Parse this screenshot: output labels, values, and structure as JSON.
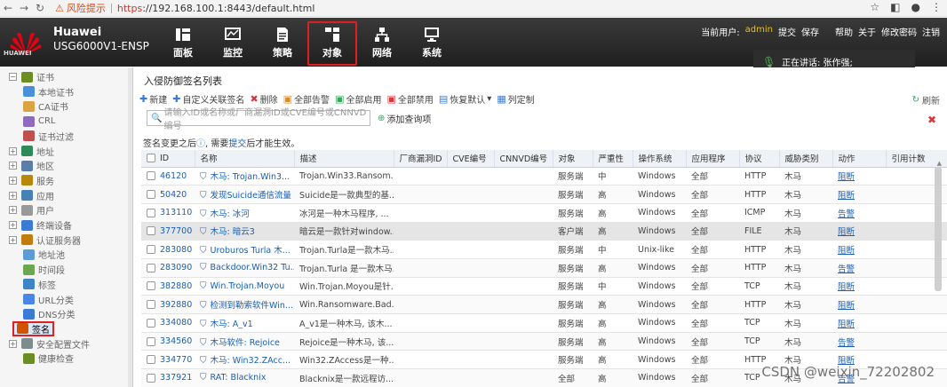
{
  "browser": {
    "warning": "风险提示",
    "url_https": "https",
    "url_rest": "://192.168.100.1:8443/default.html"
  },
  "header": {
    "brand_name": "Huawei",
    "brand_model": "USG6000V1-ENSP",
    "logo_text": "HUAWEI",
    "nav": [
      {
        "label": "面板",
        "icon": "dashboard-icon"
      },
      {
        "label": "监控",
        "icon": "monitor-icon"
      },
      {
        "label": "策略",
        "icon": "policy-icon"
      },
      {
        "label": "对象",
        "icon": "object-icon",
        "active": true
      },
      {
        "label": "网络",
        "icon": "network-icon"
      },
      {
        "label": "系统",
        "icon": "system-icon"
      }
    ],
    "current_user_label": "当前用户:",
    "user": "admin",
    "links": [
      "提交",
      "保存",
      "帮助",
      "关于",
      "修改密码",
      "注销"
    ],
    "speaking": "正在讲话: 张作强;"
  },
  "sidebar": {
    "items": [
      {
        "label": "证书",
        "level": 0,
        "toggle": "−"
      },
      {
        "label": "本地证书",
        "level": 1
      },
      {
        "label": "CA证书",
        "level": 1
      },
      {
        "label": "CRL",
        "level": 1
      },
      {
        "label": "证书过滤",
        "level": 1
      },
      {
        "label": "地址",
        "level": 0,
        "toggle": "+"
      },
      {
        "label": "地区",
        "level": 0,
        "toggle": "+"
      },
      {
        "label": "服务",
        "level": 0,
        "toggle": "+"
      },
      {
        "label": "应用",
        "level": 0,
        "toggle": "+"
      },
      {
        "label": "用户",
        "level": 0,
        "toggle": "+"
      },
      {
        "label": "终端设备",
        "level": 0,
        "toggle": "+"
      },
      {
        "label": "认证服务器",
        "level": 0,
        "toggle": "+"
      },
      {
        "label": "地址池",
        "level": 1
      },
      {
        "label": "时间段",
        "level": 1
      },
      {
        "label": "标签",
        "level": 1
      },
      {
        "label": "URL分类",
        "level": 1
      },
      {
        "label": "DNS分类",
        "level": 1
      },
      {
        "label": "签名",
        "level": 1,
        "selected": true
      },
      {
        "label": "安全配置文件",
        "level": 0,
        "toggle": "+"
      },
      {
        "label": "健康检查",
        "level": 1
      }
    ]
  },
  "content": {
    "title": "入侵防御签名列表",
    "refresh": "刷新",
    "toolbar": [
      "新建",
      "自定义关联签名",
      "删除",
      "全部告警",
      "全部启用",
      "全部禁用",
      "恢复默认",
      "列定制"
    ],
    "search_placeholder": "请输入ID或名称或厂商漏洞ID或CVE编号或CNNVD编号",
    "add_query": "添加查询项",
    "notice_pre": "签名变更之后",
    "notice_mid": ", 需要",
    "notice_link": "提交",
    "notice_post": "后才能生效。"
  },
  "table": {
    "columns": [
      "ID",
      "名称",
      "描述",
      "厂商漏洞ID",
      "CVE编号",
      "CNNVD编号",
      "对象",
      "严重性",
      "操作系统",
      "应用程序",
      "协议",
      "威胁类别",
      "动作",
      "引用计数"
    ],
    "rows": [
      {
        "id": "46120",
        "name": "木马: Trojan.Win3...",
        "desc": "Trojan.Win33.Ransom....",
        "obj": "服务端",
        "sev": "中",
        "os": "Windows",
        "app": "全部",
        "proto": "HTTP",
        "threat": "木马",
        "action": "阻断"
      },
      {
        "id": "50420",
        "name": "发现Suicide通信流量",
        "desc": "Suicide是一款典型的基...",
        "obj": "服务端",
        "sev": "高",
        "os": "Windows",
        "app": "全部",
        "proto": "HTTP",
        "threat": "木马",
        "action": "阻断"
      },
      {
        "id": "313110",
        "name": "木马: 冰河",
        "desc": "冰河是一种木马程序, ...",
        "obj": "服务端",
        "sev": "高",
        "os": "Windows",
        "app": "全部",
        "proto": "ICMP",
        "threat": "木马",
        "action": "告警"
      },
      {
        "id": "377700",
        "name": "木马: 暗云3",
        "desc": "暗云是一款针对window...",
        "obj": "客户端",
        "sev": "高",
        "os": "Windows",
        "app": "全部",
        "proto": "FILE",
        "threat": "木马",
        "action": "阻断",
        "selected": true
      },
      {
        "id": "283080",
        "name": "Uroburos Turla 木...",
        "desc": "Trojan.Turla是一款木马...",
        "obj": "服务端",
        "sev": "中",
        "os": "Unix-like",
        "app": "全部",
        "proto": "HTTP",
        "threat": "木马",
        "action": "阻断"
      },
      {
        "id": "283090",
        "name": "Backdoor.Win32 Tu...",
        "desc": "Trojan.Turla 是一款木马...",
        "obj": "服务端",
        "sev": "高",
        "os": "Windows",
        "app": "全部",
        "proto": "HTTP",
        "threat": "木马",
        "action": "告警"
      },
      {
        "id": "382880",
        "name": "Win.Trojan.Moyou",
        "desc": "Win.Trojan.Moyou是针...",
        "obj": "服务端",
        "sev": "中",
        "os": "Windows",
        "app": "全部",
        "proto": "TCP",
        "threat": "木马",
        "action": "阻断"
      },
      {
        "id": "392880",
        "name": "检测到勒索软件Win...",
        "desc": "Win.Ransomware.Bad....",
        "obj": "服务端",
        "sev": "高",
        "os": "Windows",
        "app": "全部",
        "proto": "HTTP",
        "threat": "木马",
        "action": "阻断"
      },
      {
        "id": "334080",
        "name": "木马: A_v1",
        "desc": "A_v1是一种木马, 该木...",
        "obj": "服务端",
        "sev": "高",
        "os": "Windows",
        "app": "全部",
        "proto": "TCP",
        "threat": "木马",
        "action": "阻断"
      },
      {
        "id": "334560",
        "name": "木马软件: Rejoice",
        "desc": "Rejoice是一种木马, 该...",
        "obj": "服务端",
        "sev": "高",
        "os": "Windows",
        "app": "全部",
        "proto": "TCP",
        "threat": "木马",
        "action": "告警"
      },
      {
        "id": "334770",
        "name": "木马: Win32.ZAcc...",
        "desc": "Win32.ZAccess是一种...",
        "obj": "服务端",
        "sev": "高",
        "os": "Windows",
        "app": "全部",
        "proto": "HTTP",
        "threat": "木马",
        "action": "阻断"
      },
      {
        "id": "337921",
        "name": "RAT: Blacknix",
        "desc": "Blacknix是一款远程访...",
        "obj": "全部",
        "sev": "高",
        "os": "Windows",
        "app": "全部",
        "proto": "TCP",
        "threat": "木马",
        "action": "告警"
      }
    ]
  },
  "watermark": "CSDN @weixin_72202802"
}
